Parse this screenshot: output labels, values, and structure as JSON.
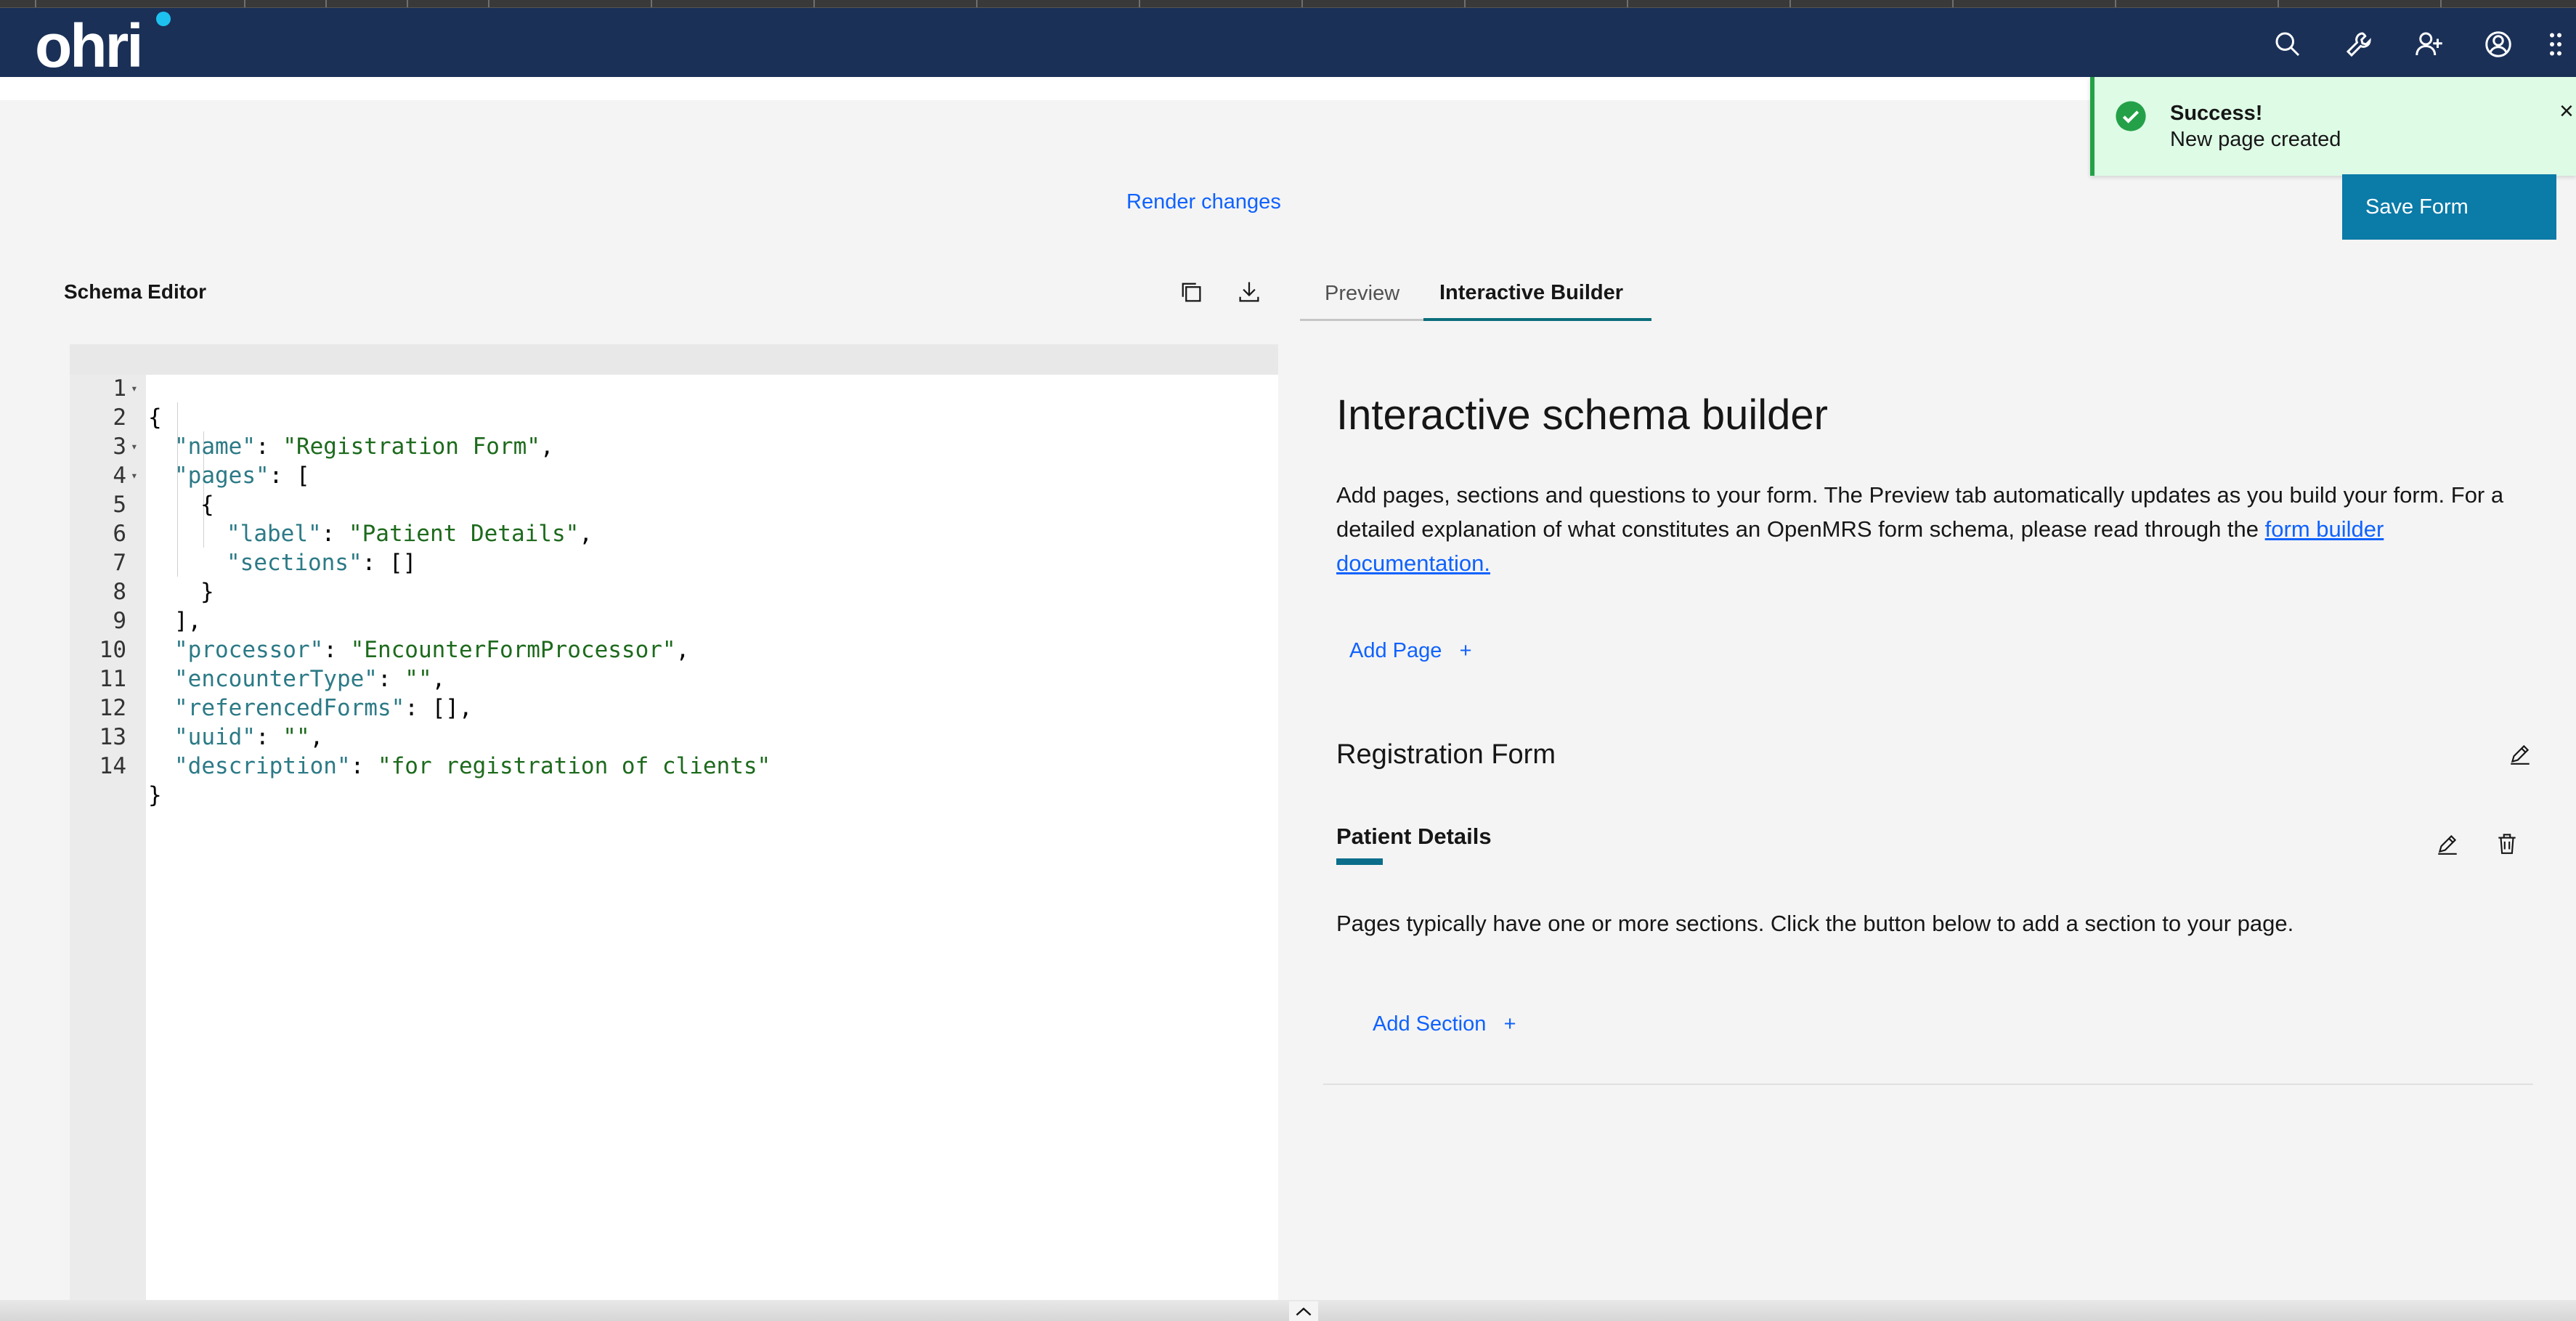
{
  "header": {
    "logo_text": "ohri",
    "icons": [
      "search-icon",
      "tools-icon",
      "add-user-icon",
      "user-avatar-icon",
      "app-switcher-icon"
    ]
  },
  "toast": {
    "title": "Success!",
    "subtitle": "New page created",
    "close": "×",
    "kind": "success",
    "color": "#24a148"
  },
  "toolbar": {
    "render_label": "Render changes",
    "save_label": "Save Form",
    "save_color": "#0b7ba8"
  },
  "schema_editor": {
    "title": "Schema Editor",
    "lines": [
      {
        "n": "1",
        "text": "{"
      },
      {
        "n": "2",
        "text": "\"name\": \"Registration Form\","
      },
      {
        "n": "3",
        "text": "\"pages\": ["
      },
      {
        "n": "4",
        "text": "{"
      },
      {
        "n": "5",
        "text": "\"label\": \"Patient Details\","
      },
      {
        "n": "6",
        "text": "\"sections\": []"
      },
      {
        "n": "7",
        "text": "}"
      },
      {
        "n": "8",
        "text": "],"
      },
      {
        "n": "9",
        "text": "\"processor\": \"EncounterFormProcessor\","
      },
      {
        "n": "10",
        "text": "\"encounterType\": \"\","
      },
      {
        "n": "11",
        "text": "\"referencedForms\": [],"
      },
      {
        "n": "12",
        "text": "\"uuid\": \"\","
      },
      {
        "n": "13",
        "text": "\"description\": \"for registration of clients\""
      },
      {
        "n": "14",
        "text": "}"
      }
    ]
  },
  "tabs": {
    "preview": "Preview",
    "interactive_builder": "Interactive Builder",
    "active": "interactive_builder"
  },
  "builder": {
    "heading": "Interactive schema builder",
    "description_1": "Add pages, sections and questions to your form. The Preview tab automatically updates as you build your form. For a detailed explanation of what constitutes an OpenMRS form schema, please read through the ",
    "doc_link": "form builder documentation.",
    "add_page": "Add Page",
    "form_name": "Registration Form",
    "page_label": "Patient Details",
    "sections_help": "Pages typically have one or more sections. Click the button below to add a section to your page.",
    "add_section": "Add Section",
    "plus": "+"
  }
}
